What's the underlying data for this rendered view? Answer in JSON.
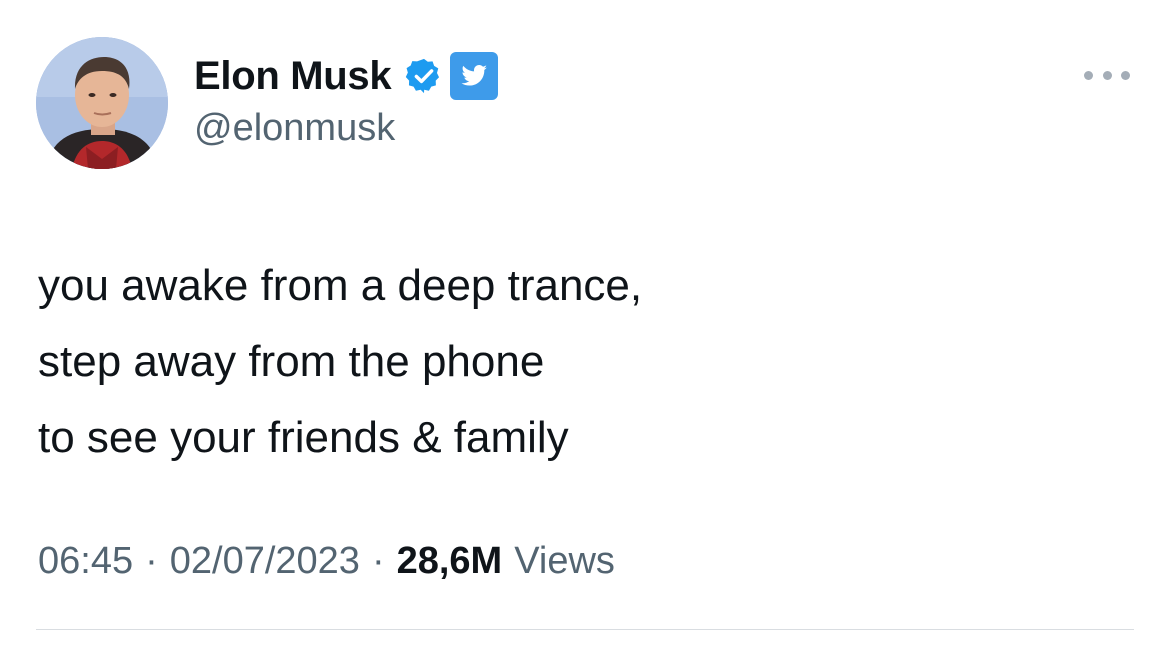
{
  "tweet": {
    "author": {
      "display_name": "Elon Musk",
      "handle": "@elonmusk",
      "verified_icon": "verified-badge-icon",
      "affiliate_icon": "twitter-bird-icon"
    },
    "more_icon": "more-options-icon",
    "text_lines": [
      "you awake from a deep trance,",
      "step away from the phone",
      "to see your friends & family"
    ],
    "meta": {
      "time": "06:45",
      "separator": "·",
      "date": "02/07/2023",
      "views_count": "28,6M",
      "views_label": "Views"
    }
  },
  "colors": {
    "text_primary": "#0f1419",
    "text_secondary": "#536471",
    "verified_blue": "#1d9bf0",
    "twitter_badge_blue": "#3e9bea",
    "divider": "#d9dde1"
  }
}
